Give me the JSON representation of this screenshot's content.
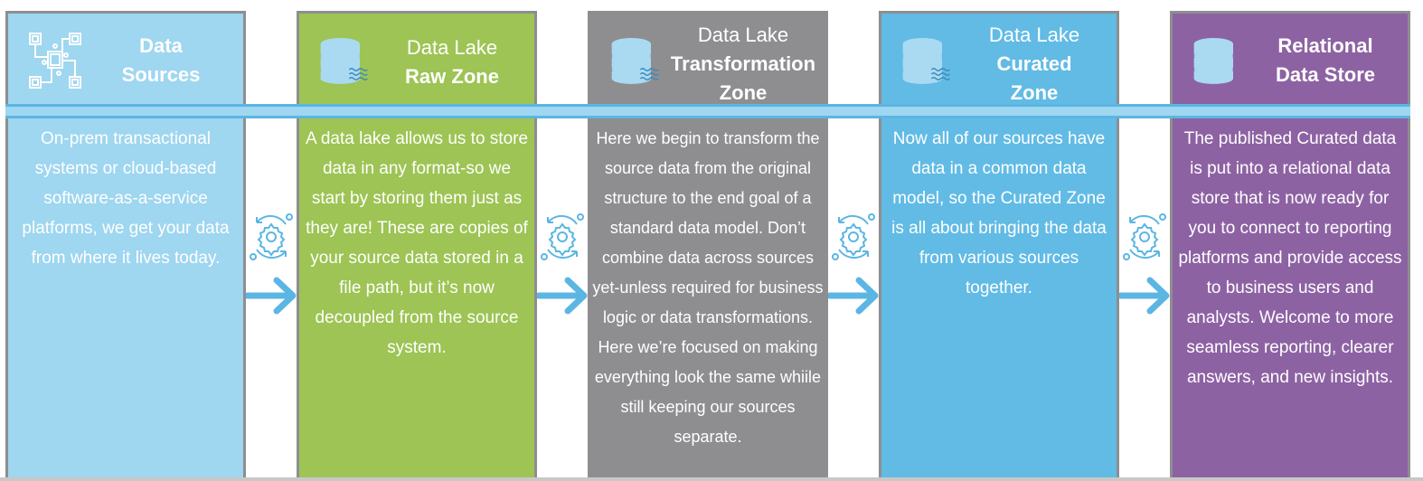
{
  "diagram": {
    "type": "data-pipeline-flow",
    "colors": {
      "data_sources": "#9fd6f0",
      "raw_zone": "#9dc454",
      "transformation_zone": "#8e8e90",
      "curated_zone": "#61bbe5",
      "relational_store": "#8d62a3",
      "band": "#9fd6f0",
      "connector": "#5bb6e3",
      "border": "#8e8e90"
    },
    "stages": [
      {
        "id": "data-sources",
        "icon": "circuit-network-icon",
        "title_light": "",
        "title_bold": "Data\nSources",
        "title_bold_lines": [
          "Data",
          "Sources"
        ],
        "description": "On-prem transactional systems or cloud-based software-as-a-service platforms, we get your data from where it lives today."
      },
      {
        "id": "raw-zone",
        "icon": "database-lake-icon",
        "title_light": "Data Lake",
        "title_bold_lines": [
          "Raw Zone"
        ],
        "description": "A data lake allows us to store data in any format-so we start by storing them just as they are! These are copies of your source data stored in a file path, but it’s now decoupled from the source system."
      },
      {
        "id": "transformation-zone",
        "icon": "database-lake-icon",
        "title_light": "Data Lake",
        "title_bold_lines": [
          "Transformation",
          "Zone"
        ],
        "description": "Here we begin to transform the source data from the original structure to the end goal of a standard data model. Don’t combine data across sources yet-unless required for business logic or data transformations. Here we’re focused on making everything look the same whiile still keeping our sources separate."
      },
      {
        "id": "curated-zone",
        "icon": "database-lake-icon",
        "title_light": "Data Lake",
        "title_bold_lines": [
          "Curated",
          "Zone"
        ],
        "description": "Now all of our sources have data in a common data model, so the Curated Zone is all about bringing the data from various sources together."
      },
      {
        "id": "relational-data-store",
        "icon": "database-icon",
        "title_light": "",
        "title_bold_lines": [
          "Relational",
          "Data Store"
        ],
        "description": "The published Curated data is put into a relational data store that is now ready for you to connect to reporting platforms and provide access to business users and analysts. Welcome to more seamless reporting, clearer answers, and new insights."
      }
    ],
    "connectors": [
      {
        "icons": [
          "gear-cycle-icon",
          "arrow-right-icon"
        ]
      },
      {
        "icons": [
          "gear-cycle-icon",
          "arrow-right-icon"
        ]
      },
      {
        "icons": [
          "gear-cycle-icon",
          "arrow-right-icon"
        ]
      },
      {
        "icons": [
          "gear-cycle-icon",
          "arrow-right-icon"
        ]
      }
    ]
  }
}
